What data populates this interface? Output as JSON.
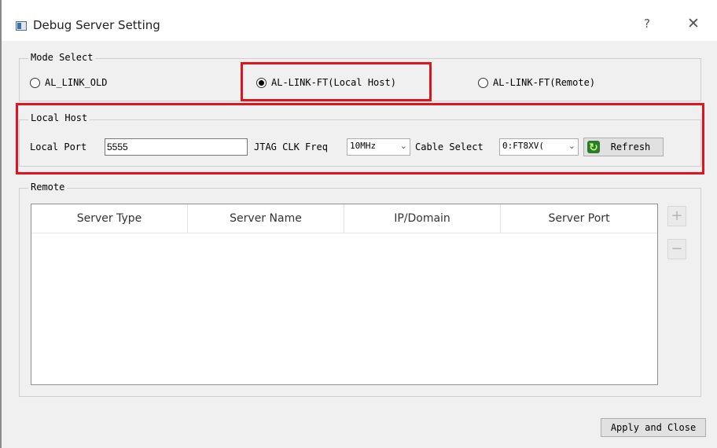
{
  "window": {
    "title": "Debug Server Setting",
    "help_label": "?",
    "close_label": "✕"
  },
  "mode_select": {
    "title": "Mode Select",
    "options": [
      {
        "label": "AL_LINK_OLD",
        "checked": false
      },
      {
        "label": "AL-LINK-FT(Local Host)",
        "checked": true
      },
      {
        "label": "AL-LINK-FT(Remote)",
        "checked": false
      }
    ]
  },
  "local_host": {
    "title": "Local Host",
    "port_label": "Local Port",
    "port_value": "5555",
    "jtag_label": "JTAG CLK Freq",
    "jtag_value": "10MHz",
    "cable_label": "Cable Select",
    "cable_value": "0:FT8XV(",
    "refresh_label": "Refresh"
  },
  "remote": {
    "title": "Remote",
    "columns": [
      "Server Type",
      "Server Name",
      "IP/Domain",
      "Server Port"
    ],
    "add_label": "+",
    "remove_label": "−"
  },
  "footer": {
    "apply_label": "Apply and Close"
  },
  "colors": {
    "highlight": "#e0141e",
    "window_bg": "#f0f0f0"
  }
}
